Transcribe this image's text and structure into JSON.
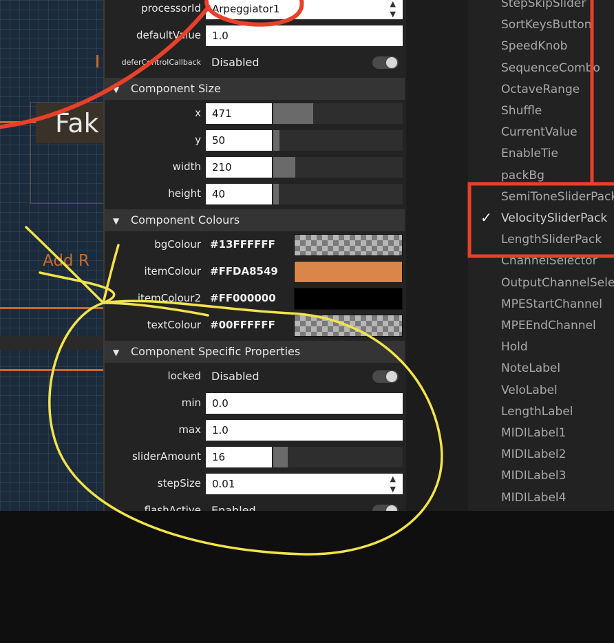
{
  "canvas": {
    "fake_label": "Fak",
    "add_label": "Add  R"
  },
  "rows_top": [
    {
      "label": "processorId",
      "value": "Arpeggiator1"
    },
    {
      "label": "defaultValue",
      "value": "1.0"
    },
    {
      "label": "deferControlCallback",
      "value": "Disabled"
    }
  ],
  "sections": {
    "size": "Component Size",
    "colours": "Component Colours",
    "specific": "Component Specific Properties"
  },
  "size_rows": [
    {
      "label": "x",
      "value": "471",
      "slider": 0.31
    },
    {
      "label": "y",
      "value": "50",
      "slider": 0.05
    },
    {
      "label": "width",
      "value": "210",
      "slider": 0.17
    },
    {
      "label": "height",
      "value": "40",
      "slider": 0.04
    }
  ],
  "colour_rows": [
    {
      "label": "bgColour",
      "value": "#13FFFFFF",
      "swatch": "checker"
    },
    {
      "label": "itemColour",
      "value": "#FFDA8549",
      "swatch": "#DA8549"
    },
    {
      "label": "itemColour2",
      "value": "#FF000000",
      "swatch": "#000000"
    },
    {
      "label": "textColour",
      "value": "#00FFFFFF",
      "swatch": "checker"
    }
  ],
  "specific_rows": {
    "locked": {
      "label": "locked",
      "value": "Disabled"
    },
    "min": {
      "label": "min",
      "value": "0.0"
    },
    "max": {
      "label": "max",
      "value": "1.0"
    },
    "sliderAmount": {
      "label": "sliderAmount",
      "value": "16",
      "slider": 0.11
    },
    "stepSize": {
      "label": "stepSize",
      "value": "0.01"
    },
    "flashActive": {
      "label": "flashActive",
      "value": "Enabled"
    }
  },
  "right_list": [
    "StepSkipSlider",
    "SortKeysButton",
    "SpeedKnob",
    "SequenceCombo",
    "OctaveRange",
    "Shuffle",
    "CurrentValue",
    "EnableTie",
    "packBg",
    "SemiToneSliderPack",
    "VelocitySliderPack",
    "LengthSliderPack",
    "ChannelSelector",
    "OutputChannelSelector",
    "MPEStartChannel",
    "MPEEndChannel",
    "Hold",
    "NoteLabel",
    "VeloLabel",
    "LengthLabel",
    "MIDILabel1",
    "MIDILabel2",
    "MIDILabel3",
    "MIDILabel4"
  ],
  "selected_item": "VelocitySliderPack",
  "colors": {
    "annotation_red": "#e8402a",
    "annotation_yellow": "#f2e34a",
    "accent_orange": "#c96a2a"
  }
}
